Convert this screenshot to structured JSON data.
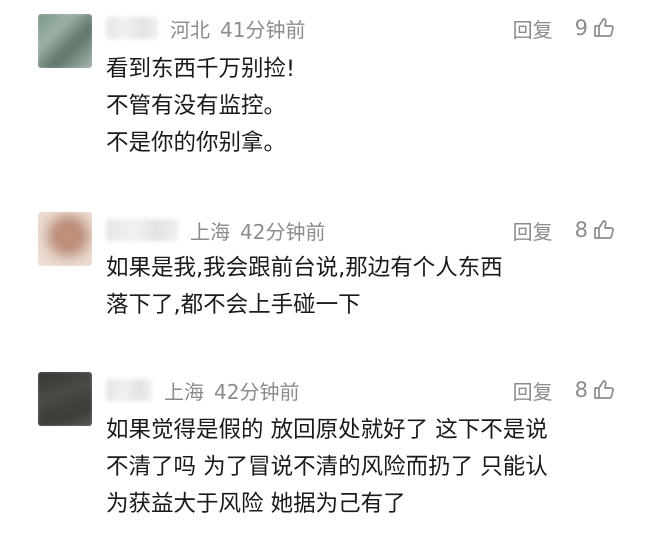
{
  "comments": [
    {
      "location": "河北",
      "time": "41分钟前",
      "reply_label": "回复",
      "likes": "9",
      "lines": [
        "看到东西千万别捡!",
        "不管有没有监控。",
        "不是你的你别拿。"
      ]
    },
    {
      "location": "上海",
      "time": "42分钟前",
      "reply_label": "回复",
      "likes": "8",
      "lines": [
        "如果是我,我会跟前台说,那边有个人东西",
        "落下了,都不会上手碰一下"
      ]
    },
    {
      "location": "上海",
      "time": "42分钟前",
      "reply_label": "回复",
      "likes": "8",
      "lines": [
        "如果觉得是假的 放回原处就好了 这下不是说",
        "不清了吗 为了冒说不清的风险而扔了 只能认",
        "为获益大于风险 她据为己有了"
      ]
    }
  ],
  "colors": {
    "meta_text": "#8c8c8c",
    "body_text": "#1a1a1a",
    "background": "#ffffff"
  },
  "icons": {
    "like": "thumbs-up-icon",
    "avatar": "blurred-avatar"
  }
}
